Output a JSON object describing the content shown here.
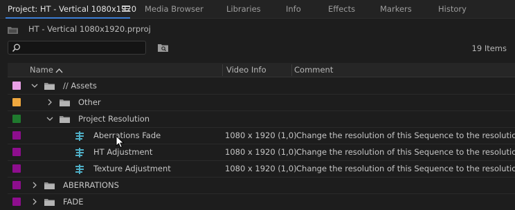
{
  "tabs": [
    {
      "label": "Project: HT - Vertical 1080x1920",
      "active": true
    },
    {
      "label": "Media Browser"
    },
    {
      "label": "Libraries"
    },
    {
      "label": "Info"
    },
    {
      "label": "Effects"
    },
    {
      "label": "Markers"
    },
    {
      "label": "History"
    }
  ],
  "project": {
    "filename": "HT - Vertical 1080x1920.prproj"
  },
  "search": {
    "value": "",
    "placeholder": ""
  },
  "items_count": "19 Items",
  "columns": {
    "name": "Name",
    "video_info": "Video Info",
    "comment": "Comment"
  },
  "rows": [
    {
      "name": "// Assets",
      "type": "folder",
      "expanded": true,
      "label_color": "#e9a0e6"
    },
    {
      "name": "Other",
      "type": "folder",
      "expanded": false,
      "label_color": "#f0a83e"
    },
    {
      "name": "Project Resolution",
      "type": "folder",
      "expanded": true,
      "label_color": "#1f7a2e"
    },
    {
      "name": "Aberrations Fade",
      "type": "sequence",
      "label_color": "#8e0e8e",
      "video_info": "1080 x 1920 (1,0)",
      "comment": "Change the resolution of this Sequence to the resolution appro"
    },
    {
      "name": "HT Adjustment",
      "type": "sequence",
      "label_color": "#8e0e8e",
      "video_info": "1080 x 1920 (1,0)",
      "comment": "Change the resolution of this Sequence to the resolution appro"
    },
    {
      "name": "Texture Adjustment",
      "type": "sequence",
      "label_color": "#8e0e8e",
      "video_info": "1080 x 1920 (1,0)",
      "comment": "Change the resolution of this Sequence to the resolution appro"
    },
    {
      "name": "ABERRATIONS",
      "type": "folder",
      "expanded": false,
      "label_color": "#8e0e8e"
    },
    {
      "name": "FADE",
      "type": "folder",
      "expanded": false,
      "label_color": "#8e0e8e"
    }
  ],
  "colors": {
    "accent": "#3d7fd6",
    "panel_bg": "#1d1d1d"
  }
}
